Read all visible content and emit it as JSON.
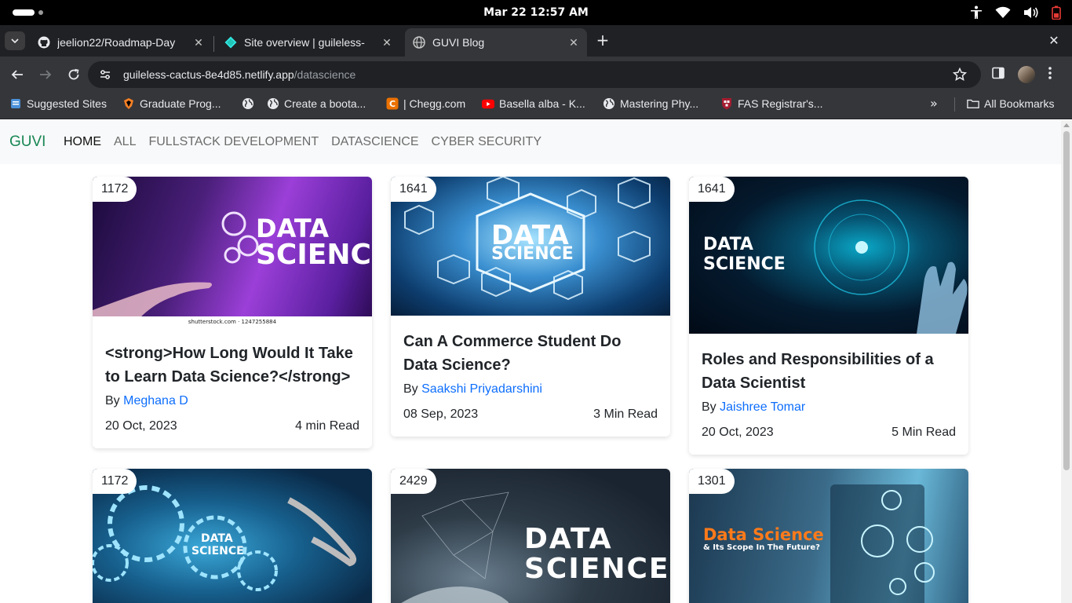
{
  "os": {
    "clock": "Mar 22  12:57 AM"
  },
  "tabs": [
    {
      "title": "jeelion22/Roadmap-Day",
      "icon": "github-icon",
      "active": false
    },
    {
      "title": "Site overview | guileless-",
      "icon": "netlify-icon",
      "active": false
    },
    {
      "title": "GUVI Blog",
      "icon": "globe-icon",
      "active": true
    }
  ],
  "toolbar": {
    "url_host": "guileless-cactus-8e4d85.netlify.app",
    "url_path": "/datascience"
  },
  "bookmarks": [
    {
      "label": "Suggested Sites",
      "icon": "bookmark-icon"
    },
    {
      "label": "Graduate Prog...",
      "icon": "shield-icon"
    },
    {
      "label": "",
      "icon": "globe-icon"
    },
    {
      "label": "Create a boota...",
      "icon": "globe-icon"
    },
    {
      "label": "| Chegg.com",
      "icon": "chegg-icon"
    },
    {
      "label": "Basella alba - K...",
      "icon": "youtube-icon"
    },
    {
      "label": "Mastering Phy...",
      "icon": "globe-icon"
    },
    {
      "label": "FAS Registrar's...",
      "icon": "crest-icon"
    }
  ],
  "all_bookmarks_label": "All Bookmarks",
  "site": {
    "brand": "GUVI",
    "nav": [
      "HOME",
      "ALL",
      "FULLSTACK DEVELOPMENT",
      "DATASCIENCE",
      "CYBER SECURITY"
    ]
  },
  "cards": [
    {
      "views": "1172",
      "image_text": [
        "DATA",
        "SCIENCE"
      ],
      "image_caption": "shutterstock.com · 1247255884",
      "title": "<strong>How Long Would It Take to Learn Data Science?</strong>",
      "by": "By",
      "author": "Meghana D",
      "date": "20 Oct, 2023",
      "read": "4 min Read"
    },
    {
      "views": "1641",
      "image_text": [
        "DATA",
        "SCIENCE"
      ],
      "title": "Can A Commerce Student Do Data Science?",
      "by": "By",
      "author": "Saakshi Priyadarshini",
      "date": "08 Sep, 2023",
      "read": "3 Min Read"
    },
    {
      "views": "1641",
      "image_text": [
        "DATA",
        "SCIENCE"
      ],
      "title": "Roles and Responsibilities of a Data Scientist",
      "by": "By",
      "author": "Jaishree Tomar",
      "date": "20 Oct, 2023",
      "read": "5 Min Read"
    },
    {
      "views": "1172",
      "image_text": [
        "DATA",
        "SCIENCE"
      ]
    },
    {
      "views": "2429",
      "image_text": [
        "DATA",
        "SCIENCE"
      ]
    },
    {
      "views": "1301",
      "image_text": [
        "Data Science",
        "& Its Scope In The Future?"
      ]
    }
  ],
  "colors": {
    "brand": "#198754",
    "link": "#0d6efd",
    "nav_bg": "#f8f9fa",
    "browser_dark": "#202124",
    "browser_toolbar": "#35363a"
  }
}
